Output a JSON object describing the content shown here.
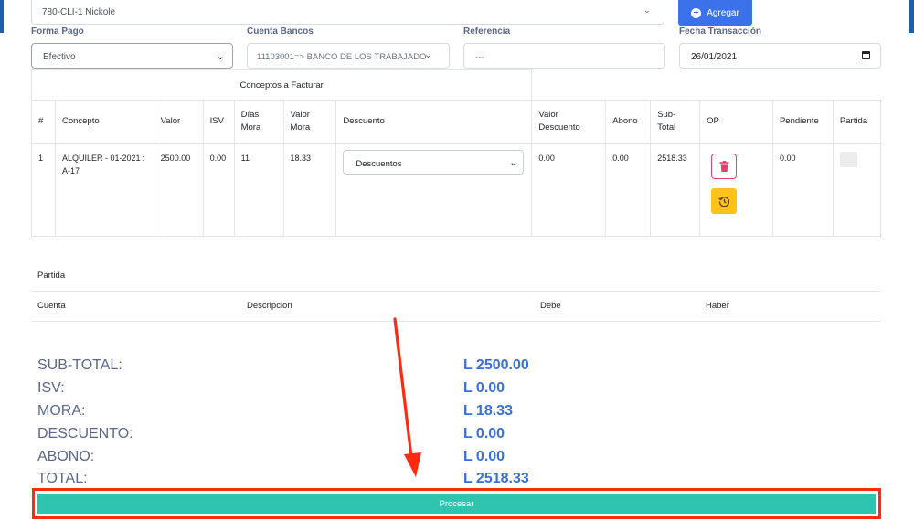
{
  "header": {
    "client_value": "780-CLI-1 Nickole",
    "add_button_label": "Agregar"
  },
  "form": {
    "forma_pago_label": "Forma Pago",
    "forma_pago_value": "Efectivo",
    "cuenta_bancos_label": "Cuenta Bancos",
    "cuenta_bancos_value": "11103001=> BANCO DE LOS TRABAJADO",
    "referencia_label": "Referencia",
    "referencia_placeholder": "---",
    "fecha_label": "Fecha Transacción",
    "fecha_value": "26/01/2021"
  },
  "conceptos": {
    "title": "Conceptos a Facturar",
    "columns": {
      "num": "#",
      "concepto": "Concepto",
      "valor": "Valor",
      "isv": "ISV",
      "dias_mora_1": "Días",
      "dias_mora_2": "Mora",
      "valor_mora_1": "Valor",
      "valor_mora_2": "Mora",
      "descuento": "Descuento",
      "valor_descuento_1": "Valor",
      "valor_descuento_2": "Descuento",
      "abono": "Abono",
      "sub_total_1": "Sub-",
      "sub_total_2": "Total",
      "op": "OP",
      "pendiente": "Pendiente",
      "partida": "Partida"
    },
    "rows": [
      {
        "num": "1",
        "concepto_1": "ALQUILER - 01-2021 :",
        "concepto_2": "A-17",
        "valor": "2500.00",
        "isv": "0.00",
        "dias_mora": "11",
        "valor_mora": "18.33",
        "descuento": "Descuentos",
        "valor_descuento": "0.00",
        "abono": "0.00",
        "sub_total": "2518.33",
        "pendiente": "0.00"
      }
    ]
  },
  "partida": {
    "title": "Partida",
    "columns": {
      "cuenta": "Cuenta",
      "descripcion": "Descripcion",
      "debe": "Debe",
      "haber": "Haber"
    }
  },
  "totals": {
    "subtotal_label": "SUB-TOTAL:",
    "subtotal_value": "L 2500.00",
    "isv_label": "ISV:",
    "isv_value": "L 0.00",
    "mora_label": "MORA:",
    "mora_value": "L 18.33",
    "descuento_label": "DESCUENTO:",
    "descuento_value": "L 0.00",
    "abono_label": "ABONO:",
    "abono_value": "L 0.00",
    "total_label": "TOTAL:",
    "total_value": "L 2518.33"
  },
  "actions": {
    "procesar_label": "Procesar"
  },
  "colors": {
    "primary": "#3b72e9",
    "success": "#2ec4b0",
    "danger": "#e83e6c",
    "warning": "#ffc21a",
    "annotation": "#ff2a10"
  }
}
